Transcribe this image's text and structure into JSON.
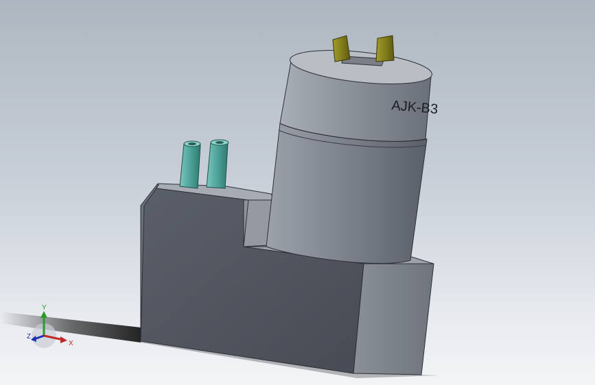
{
  "model_label": "AJK-B3",
  "axes": {
    "x_label": "X",
    "y_label": "Y",
    "z_label": "Z"
  },
  "colors": {
    "background_top": "#aeb6c1",
    "background_bottom": "#f3f4f6",
    "body_front": "#4f545e",
    "body_side": "#7e838c",
    "body_top": "#9a9fa7",
    "motor": "#80858f",
    "terminal": "#8a8520",
    "port": "#4ea39a",
    "axis_x": "#c0282a",
    "axis_y": "#2a9a2a",
    "axis_z": "#2030b0"
  }
}
